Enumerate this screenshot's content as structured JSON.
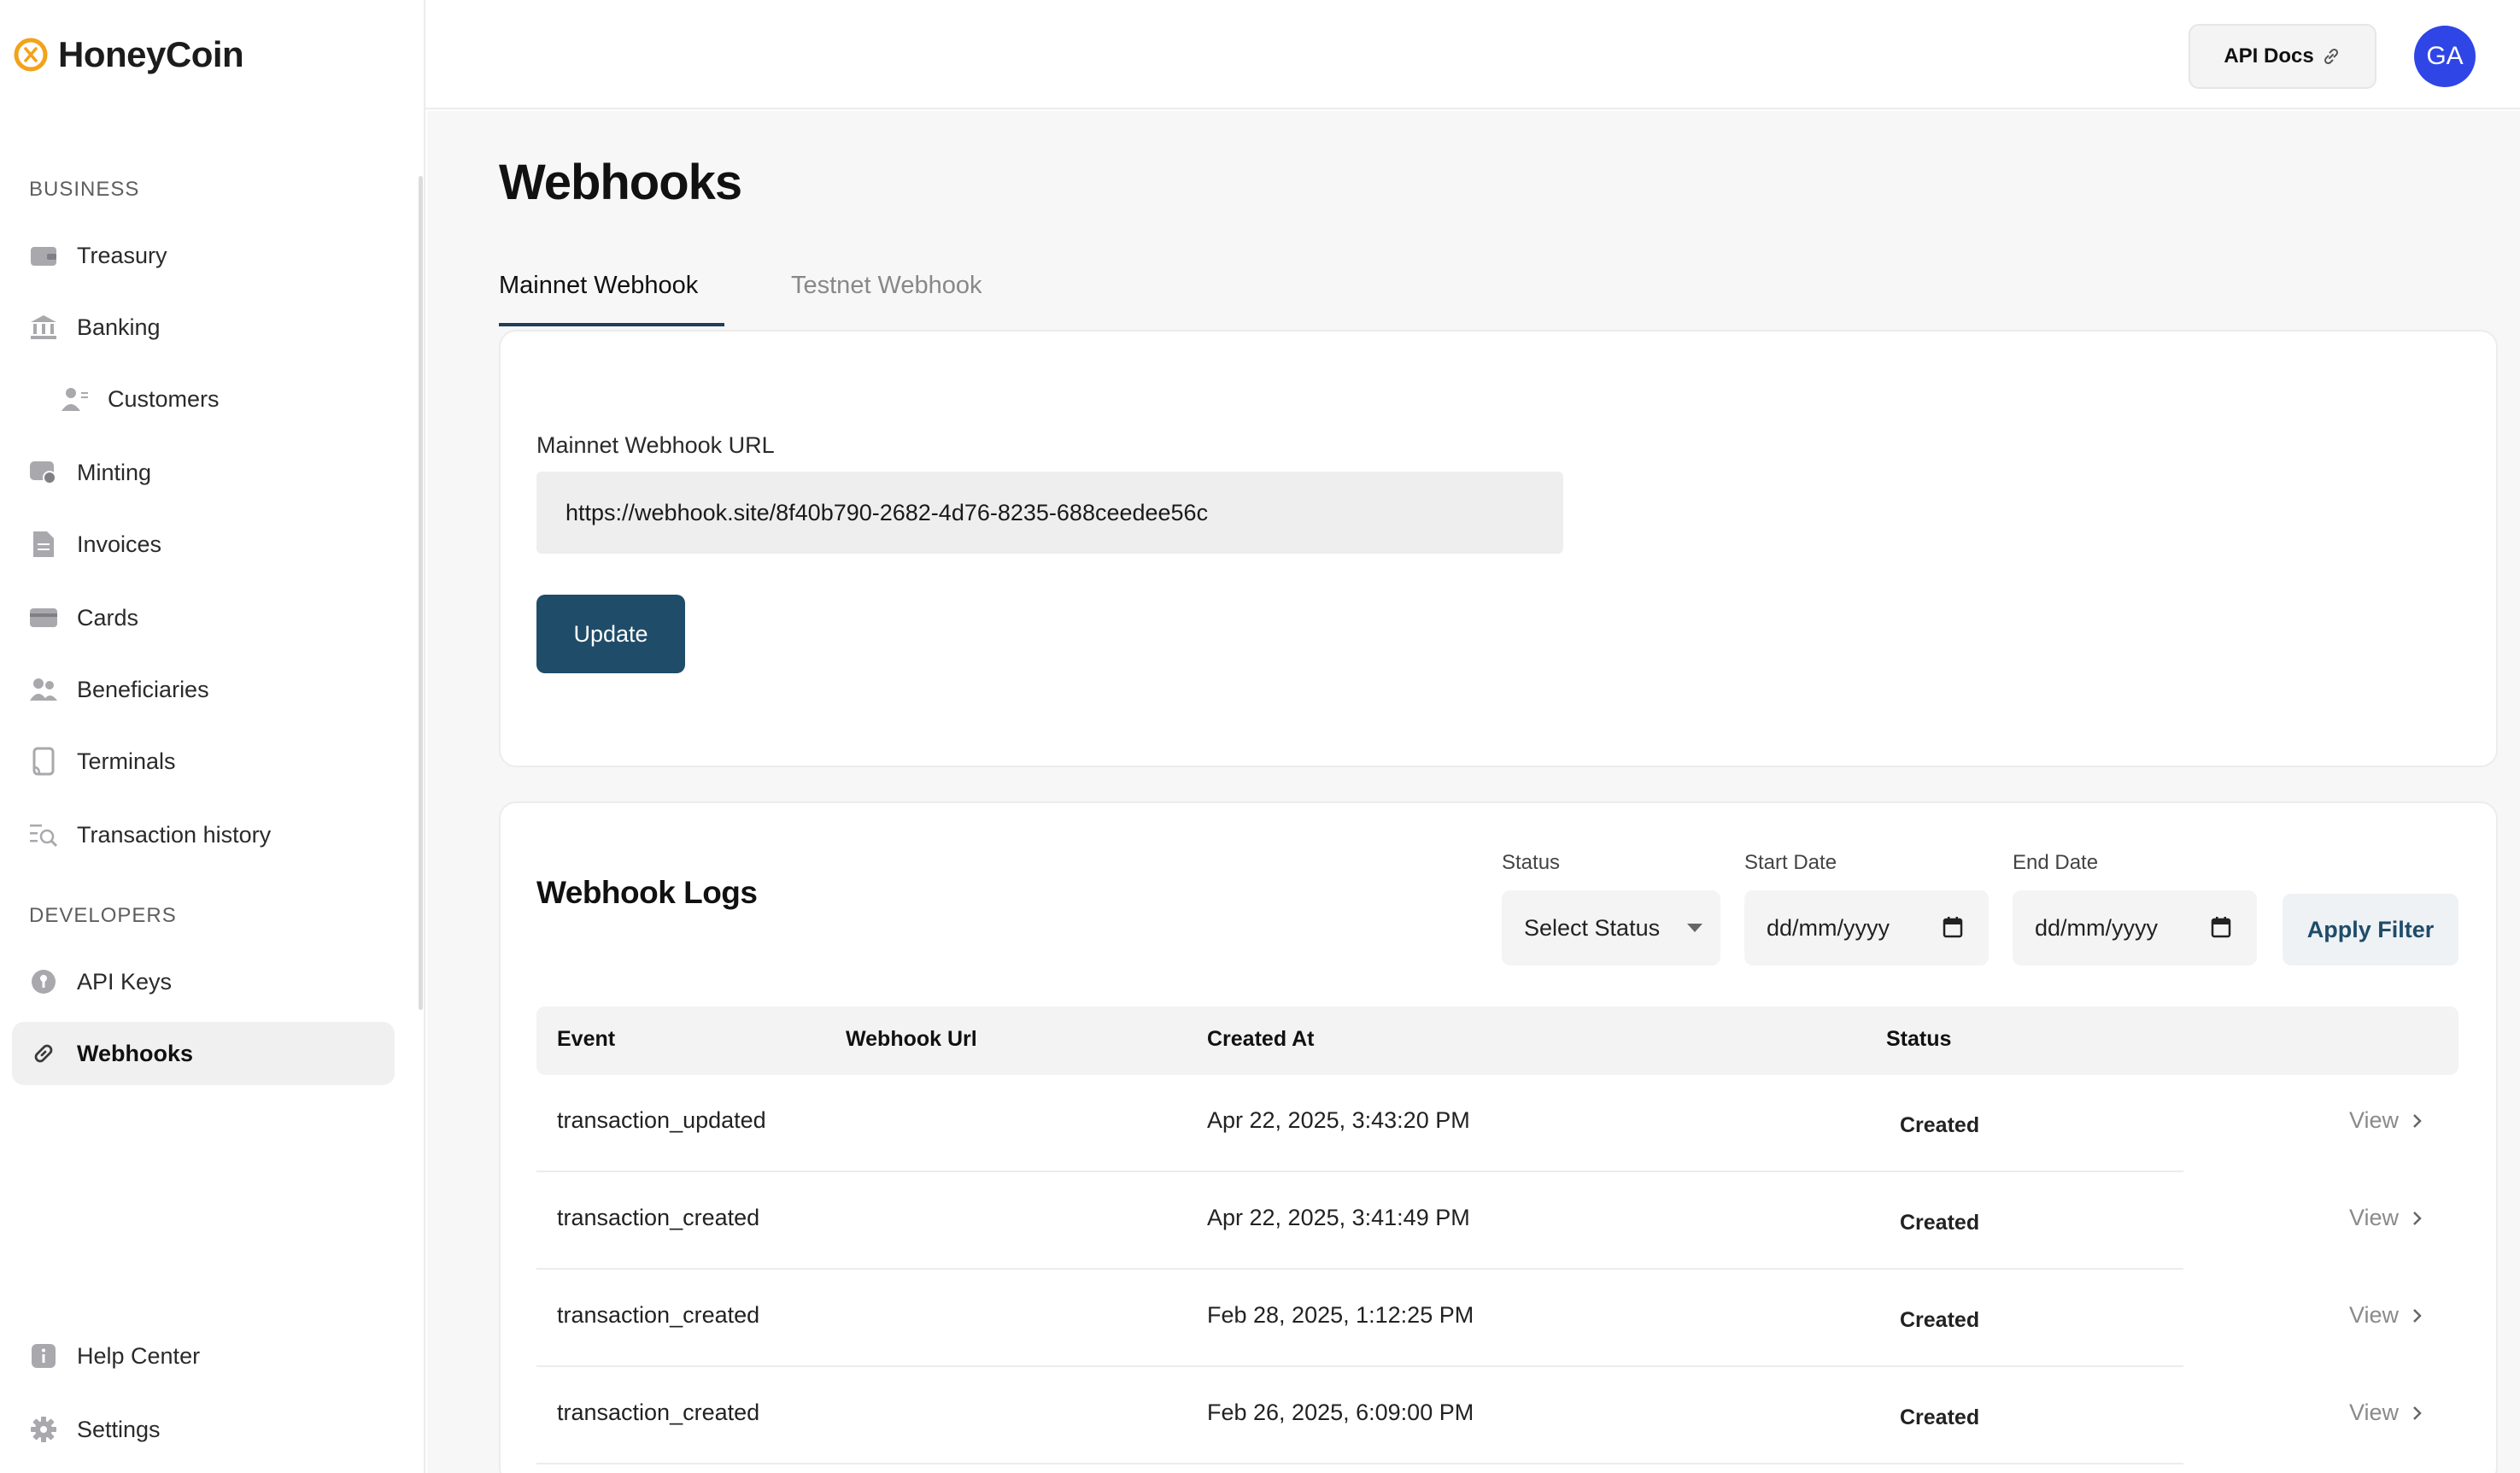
{
  "brand": {
    "name": "HoneyCoin"
  },
  "sidebar": {
    "business_heading": "BUSINESS",
    "developers_heading": "DEVELOPERS",
    "items": [
      {
        "label": "Treasury",
        "icon": "wallet-icon"
      },
      {
        "label": "Banking",
        "icon": "bank-icon"
      },
      {
        "label": "Customers",
        "icon": "customers-icon"
      },
      {
        "label": "Minting",
        "icon": "minting-icon"
      },
      {
        "label": "Invoices",
        "icon": "invoice-icon"
      },
      {
        "label": "Cards",
        "icon": "card-icon"
      },
      {
        "label": "Beneficiaries",
        "icon": "users-icon"
      },
      {
        "label": "Terminals",
        "icon": "terminal-icon"
      },
      {
        "label": "Transaction history",
        "icon": "history-search-icon"
      },
      {
        "label": "API Keys",
        "icon": "key-icon"
      },
      {
        "label": "Webhooks",
        "icon": "link-icon"
      },
      {
        "label": "Help Center",
        "icon": "info-icon"
      },
      {
        "label": "Settings",
        "icon": "gear-icon"
      }
    ],
    "active": "Webhooks"
  },
  "topbar": {
    "api_docs_label": "API Docs",
    "avatar_initials": "GA",
    "avatar_color": "#2f45e6"
  },
  "page": {
    "title": "Webhooks",
    "tabs": [
      {
        "label": "Mainnet Webhook",
        "active": true
      },
      {
        "label": "Testnet Webhook",
        "active": false
      }
    ]
  },
  "webhook_form": {
    "url_label": "Mainnet Webhook URL",
    "url_value": "https://webhook.site/8f40b790-2682-4d76-8235-688ceedee56c",
    "update_label": "Update",
    "button_color": "#1f4c68"
  },
  "logs": {
    "title": "Webhook Logs",
    "filters": {
      "status_label": "Status",
      "status_value": "Select Status",
      "start_label": "Start Date",
      "start_placeholder": "dd/mm/yyyy",
      "end_label": "End Date",
      "end_placeholder": "dd/mm/yyyy",
      "apply_label": "Apply Filter"
    },
    "columns": [
      "Event",
      "Webhook Url",
      "Created At",
      "Status"
    ],
    "rows": [
      {
        "event": "transaction_updated",
        "webhook_url": "",
        "created_at": "Apr 22, 2025, 3:43:20 PM",
        "status": "Created",
        "action": "View"
      },
      {
        "event": "transaction_created",
        "webhook_url": "",
        "created_at": "Apr 22, 2025, 3:41:49 PM",
        "status": "Created",
        "action": "View"
      },
      {
        "event": "transaction_created",
        "webhook_url": "",
        "created_at": "Feb 28, 2025, 1:12:25 PM",
        "status": "Created",
        "action": "View"
      },
      {
        "event": "transaction_created",
        "webhook_url": "",
        "created_at": "Feb 26, 2025, 6:09:00 PM",
        "status": "Created",
        "action": "View"
      }
    ]
  }
}
